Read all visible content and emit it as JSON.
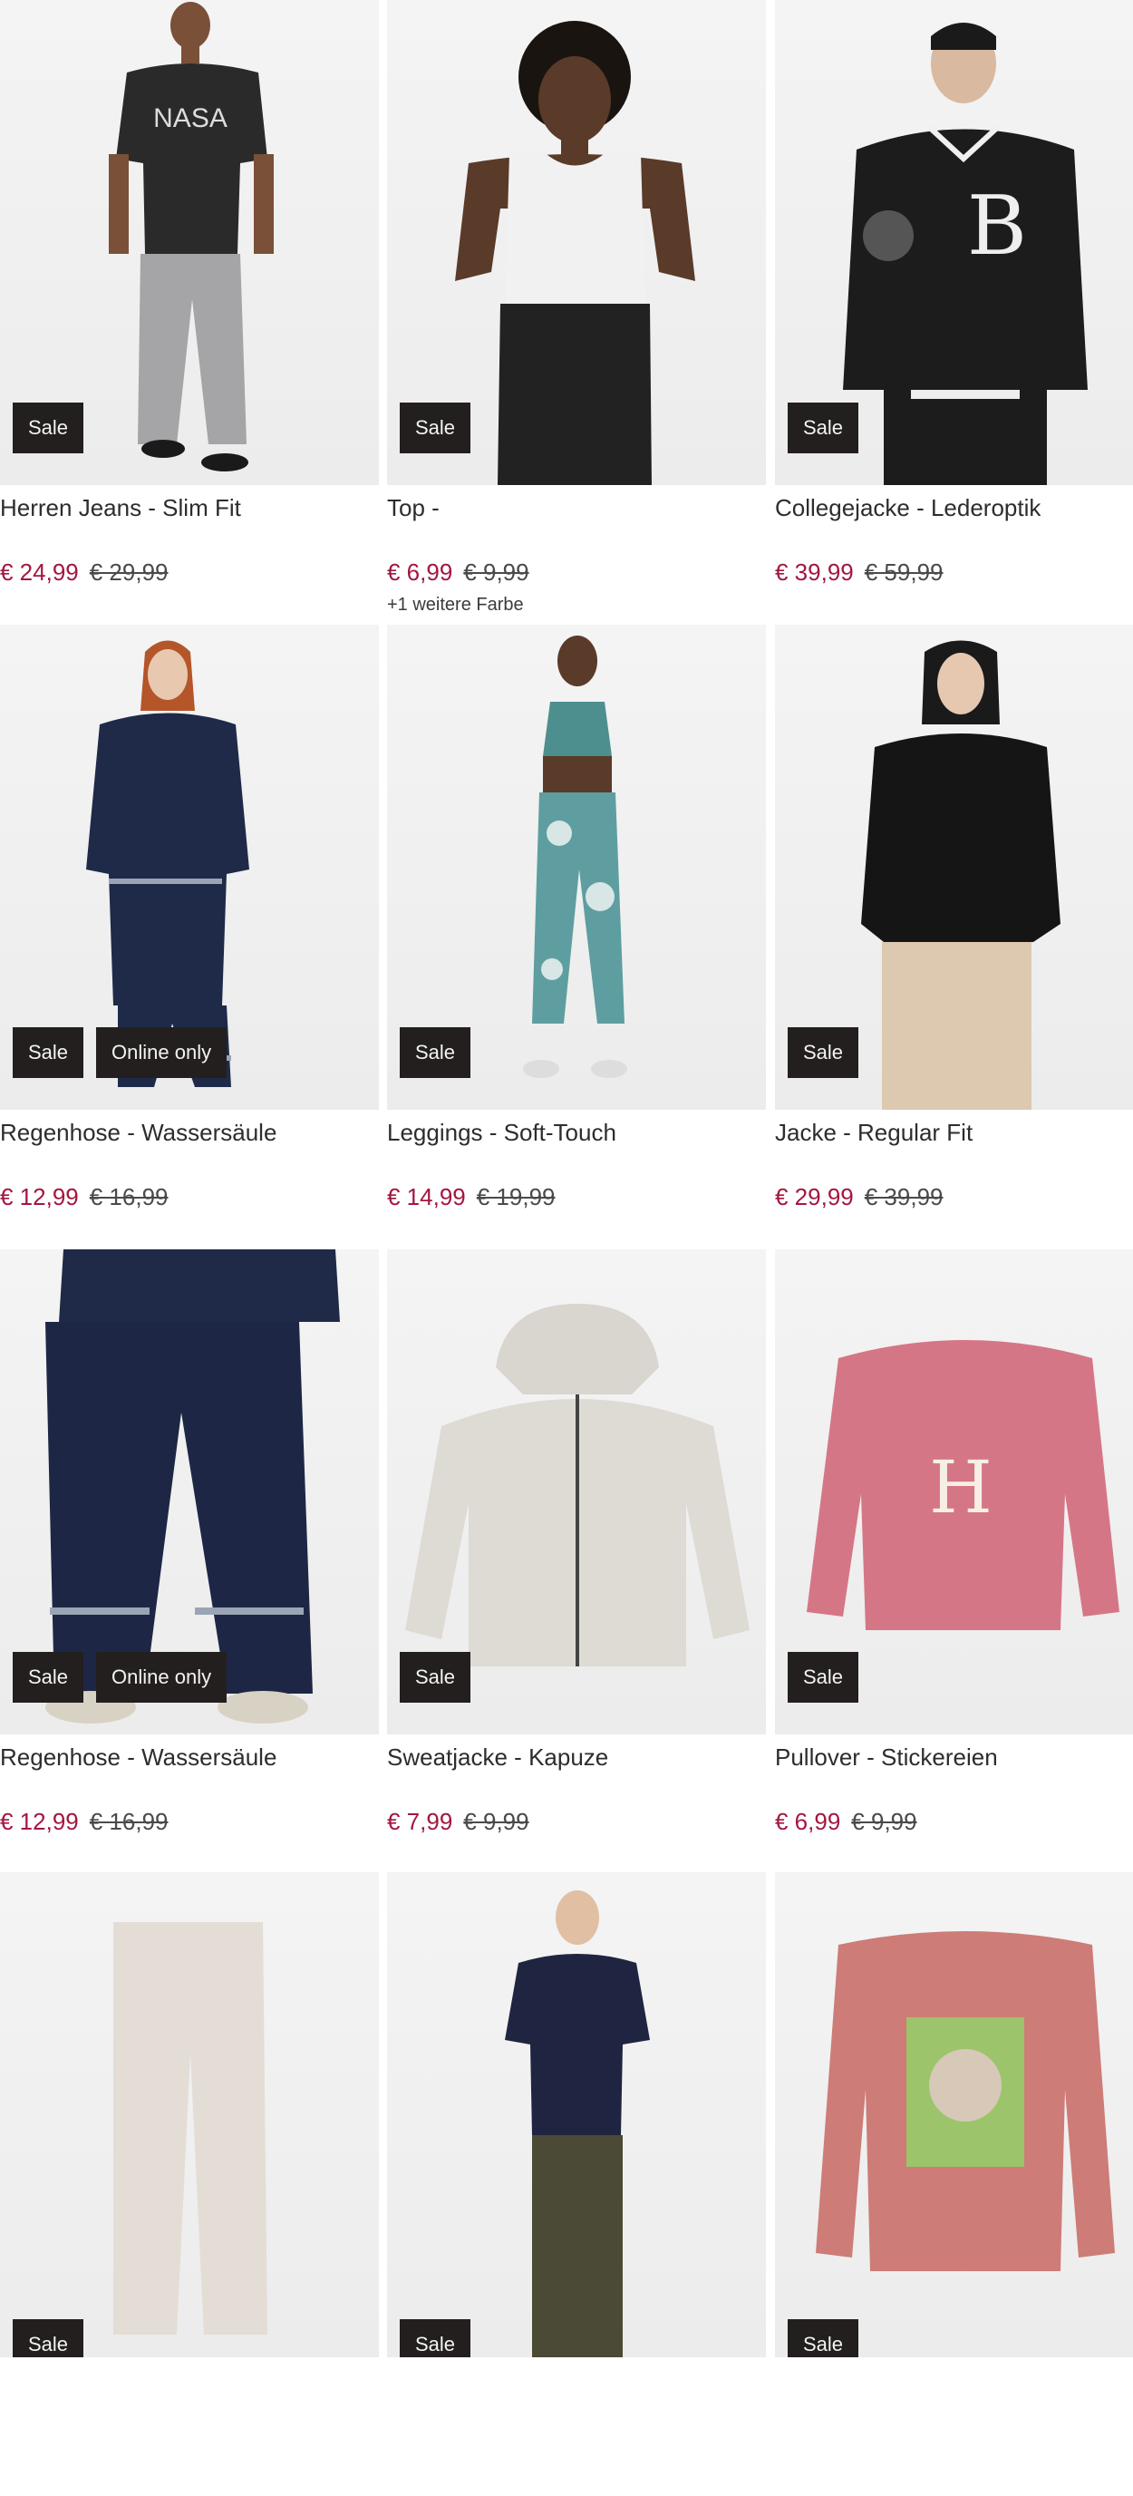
{
  "products": [
    {
      "title": "Herren Jeans - Slim Fit",
      "price": "€ 24,99",
      "old_price": "€ 29,99",
      "badges": [
        "Sale"
      ],
      "more": ""
    },
    {
      "title": "Top -",
      "price": "€ 6,99",
      "old_price": "€ 9,99",
      "badges": [
        "Sale"
      ],
      "more": "+1 weitere Farbe"
    },
    {
      "title": "Collegejacke - Lederoptik",
      "price": "€ 39,99",
      "old_price": "€ 59,99",
      "badges": [
        "Sale"
      ],
      "more": ""
    },
    {
      "title": "Regenhose - Wassersäule",
      "price": "€ 12,99",
      "old_price": "€ 16,99",
      "badges": [
        "Sale",
        "Online only"
      ],
      "more": ""
    },
    {
      "title": "Leggings - Soft-Touch",
      "price": "€ 14,99",
      "old_price": "€ 19,99",
      "badges": [
        "Sale"
      ],
      "more": ""
    },
    {
      "title": "Jacke - Regular Fit",
      "price": "€ 29,99",
      "old_price": "€ 39,99",
      "badges": [
        "Sale"
      ],
      "more": ""
    },
    {
      "title": "Regenhose - Wassersäule",
      "price": "€ 12,99",
      "old_price": "€ 16,99",
      "badges": [
        "Sale",
        "Online only"
      ],
      "more": ""
    },
    {
      "title": "Sweatjacke - Kapuze",
      "price": "€ 7,99",
      "old_price": "€ 9,99",
      "badges": [
        "Sale"
      ],
      "more": ""
    },
    {
      "title": "Pullover - Stickereien",
      "price": "€ 6,99",
      "old_price": "€ 9,99",
      "badges": [
        "Sale"
      ],
      "more": ""
    },
    {
      "title": "",
      "price": "",
      "old_price": "",
      "badges": [
        "Sale"
      ],
      "more": ""
    },
    {
      "title": "",
      "price": "",
      "old_price": "",
      "badges": [
        "Sale"
      ],
      "more": ""
    },
    {
      "title": "",
      "price": "",
      "old_price": "",
      "badges": [
        "Sale"
      ],
      "more": ""
    }
  ],
  "colors": {
    "price": "#a3173f",
    "badge_bg": "#231f1e",
    "badge_text": "#f3f3f3"
  }
}
